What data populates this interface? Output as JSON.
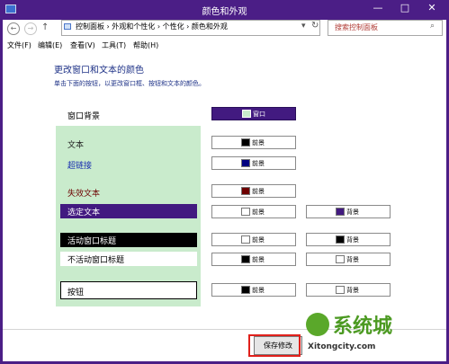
{
  "window": {
    "title": "颜色和外观",
    "minimize_glyph": "—",
    "maximize_glyph": "□",
    "close_glyph": "✕"
  },
  "nav": {
    "back_glyph": "←",
    "forward_glyph": "→",
    "up_glyph": "↑",
    "address_path": "控制面板 › 外观和个性化 › 个性化 › 颜色和外观",
    "refresh_glyph": "↻",
    "search_placeholder": "搜索控制面板"
  },
  "menu": {
    "file": "文件(F)",
    "edit": "编辑(E)",
    "view": "查看(V)",
    "tools": "工具(T)",
    "help": "帮助(H)"
  },
  "main": {
    "heading": "更改窗口和文本的颜色",
    "description": "单击下面的按钮，以更改窗口框、按钮和文本的颜色。"
  },
  "rows": {
    "window_bg": {
      "label": "窗口背景",
      "btn": "窗口",
      "swatch": "#c9ebcc"
    },
    "text": {
      "label": "文本",
      "fg": "前景",
      "swatch": "#000000"
    },
    "hyperlink": {
      "label": "超链接",
      "fg": "前景",
      "swatch": "#000080"
    },
    "disabled": {
      "label": "失效文本",
      "fg": "前景",
      "swatch": "#6d0000"
    },
    "selected": {
      "label": "选定文本",
      "fg": "前景",
      "fg_swatch": "#ffffff",
      "bg": "背景",
      "bg_swatch": "#421a80"
    },
    "active_title": {
      "label": "活动窗口标题",
      "fg": "前景",
      "fg_swatch": "#ffffff",
      "bg": "背景",
      "bg_swatch": "#000000"
    },
    "inactive_title": {
      "label": "不活动窗口标题",
      "fg": "前景",
      "fg_swatch": "#000000",
      "bg": "背景",
      "bg_swatch": "#ffffff"
    },
    "button": {
      "label": "按钮",
      "fg": "前景",
      "fg_swatch": "#000000",
      "bg": "背景",
      "bg_swatch": "#ffffff"
    }
  },
  "footer": {
    "save_label": "保存修改"
  },
  "watermark": {
    "brand": "系统城",
    "url": "Xitongcity.com"
  },
  "colors": {
    "accent": "#4b1e86",
    "highlight": "#e0201b"
  }
}
